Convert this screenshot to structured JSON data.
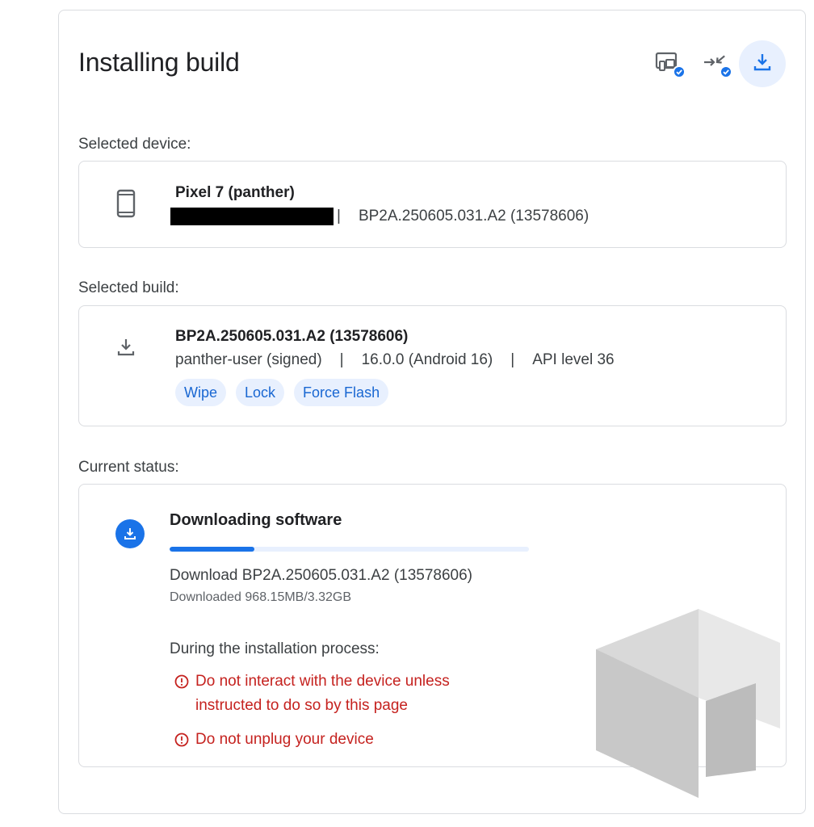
{
  "header": {
    "title": "Installing build",
    "steps": [
      {
        "icon": "device-connect-icon",
        "state": "completed"
      },
      {
        "icon": "transfer-icon",
        "state": "completed"
      },
      {
        "icon": "download-icon",
        "state": "active"
      }
    ]
  },
  "device": {
    "section_label": "Selected device:",
    "name": "Pixel 7 (panther)",
    "serial_redacted": true,
    "build": "BP2A.250605.031.A2 (13578606)",
    "icon": "phone-icon"
  },
  "build": {
    "section_label": "Selected build:",
    "id": "BP2A.250605.031.A2 (13578606)",
    "variant": "panther-user (signed)",
    "version": "16.0.0 (Android 16)",
    "api": "API level 36",
    "chips": [
      "Wipe",
      "Lock",
      "Force Flash"
    ],
    "icon": "download-icon"
  },
  "status": {
    "section_label": "Current status:",
    "title": "Downloading software",
    "progress_fraction": 0.236,
    "download_line": "Download BP2A.250605.031.A2 (13578606)",
    "downloaded": "Downloaded 968.15MB/3.32GB",
    "during_label": "During the installation process:",
    "warnings": [
      "Do not interact with the device unless instructed to do so by this page",
      "Do not unplug your device"
    ]
  },
  "colors": {
    "accent": "#1a73e8",
    "chip_bg": "#e8f0fe",
    "chip_text": "#1967d2",
    "warning": "#c5221f",
    "border": "#dadce0"
  }
}
